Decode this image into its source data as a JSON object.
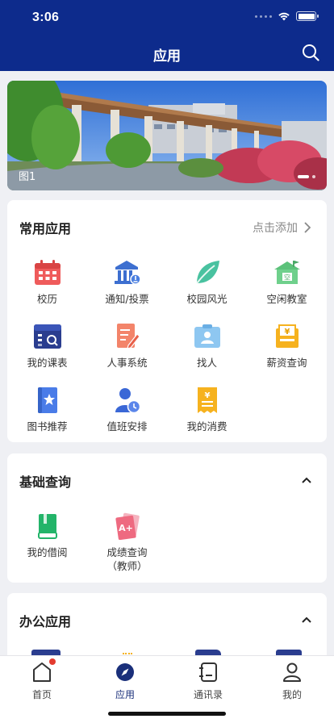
{
  "status_bar": {
    "time": "3:06"
  },
  "header": {
    "title": "应用"
  },
  "banner": {
    "caption": "图1"
  },
  "common_apps": {
    "title": "常用应用",
    "add_label": "点击添加",
    "items": [
      {
        "label": "校历",
        "icon": "calendar-icon"
      },
      {
        "label": "通知/投票",
        "icon": "building-notify-icon"
      },
      {
        "label": "校园风光",
        "icon": "leaf-icon"
      },
      {
        "label": "空闲教室",
        "icon": "classroom-icon"
      },
      {
        "label": "我的课表",
        "icon": "timetable-icon"
      },
      {
        "label": "人事系统",
        "icon": "hr-document-icon"
      },
      {
        "label": "找人",
        "icon": "contact-card-icon"
      },
      {
        "label": "薪资查询",
        "icon": "salary-icon"
      },
      {
        "label": "图书推荐",
        "icon": "book-star-icon"
      },
      {
        "label": "值班安排",
        "icon": "duty-person-clock-icon"
      },
      {
        "label": "我的消费",
        "icon": "receipt-yuan-icon"
      }
    ]
  },
  "basic_query": {
    "title": "基础查询",
    "items": [
      {
        "label": "我的借阅",
        "icon": "green-book-icon"
      },
      {
        "label": "成绩查询\n（教师）",
        "line1": "成绩查询",
        "line2": "（教师）",
        "icon": "grade-card-icon"
      }
    ]
  },
  "office_apps": {
    "title": "办公应用"
  },
  "tabbar": {
    "items": [
      {
        "label": "首页",
        "icon": "home-icon"
      },
      {
        "label": "应用",
        "icon": "compass-icon"
      },
      {
        "label": "通讯录",
        "icon": "address-book-icon"
      },
      {
        "label": "我的",
        "icon": "user-icon"
      }
    ]
  },
  "colors": {
    "header_bg": "#0d2b8c",
    "page_bg": "#eff0f4",
    "active_tab": "#1a2f7a",
    "badge": "#e33b2f"
  }
}
